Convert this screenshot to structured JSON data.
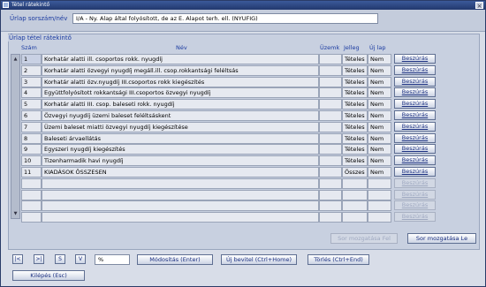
{
  "window": {
    "title": "Tétel rátekintő",
    "close": "×"
  },
  "form": {
    "label": "Űrlap sorszám/név",
    "value": "I/A  -  Ny. Alap által folyósított, de az E. Alapot terh. ell. (NYUFIG)"
  },
  "group": {
    "title": "Űrlap tétel rátekintő"
  },
  "columns": {
    "szam": "Szám",
    "nev": "Név",
    "uzemk": "Üzemk",
    "jelleg": "Jelleg",
    "ujlap": "Új lap"
  },
  "rows": [
    {
      "szam": "1",
      "nev": "Korhatár alatti ill. csoportos rokk. nyugdíj",
      "uzemk": "",
      "jelleg": "Tételes",
      "ujlap": "Nem",
      "btn": "Beszúrás"
    },
    {
      "szam": "2",
      "nev": "Korhatár alatti özvegyi nyugdíj megáll.ill. csop.rokkantsági feléltsás",
      "uzemk": "",
      "jelleg": "Tételes",
      "ujlap": "Nem",
      "btn": "Beszúrás"
    },
    {
      "szam": "3",
      "nev": "Korhatár alatti özv.nyugdíj III.csoportos rokk kiegészítés",
      "uzemk": "",
      "jelleg": "Tételes",
      "ujlap": "Nem",
      "btn": "Beszúrás"
    },
    {
      "szam": "4",
      "nev": "Együttfolyósított rokkantsági III.csoportos özvegyi nyugdíj",
      "uzemk": "",
      "jelleg": "Tételes",
      "ujlap": "Nem",
      "btn": "Beszúrás"
    },
    {
      "szam": "5",
      "nev": "Korhatár alatti III. csop. baleseti rokk. nyugdíj",
      "uzemk": "",
      "jelleg": "Tételes",
      "ujlap": "Nem",
      "btn": "Beszúrás"
    },
    {
      "szam": "6",
      "nev": "Özvegyi nyugdíj üzemi baleset feléltsáskent",
      "uzemk": "",
      "jelleg": "Tételes",
      "ujlap": "Nem",
      "btn": "Beszúrás"
    },
    {
      "szam": "7",
      "nev": "Üzemi baleset miatti özvegyi nyugdíj kiegészítése",
      "uzemk": "",
      "jelleg": "Tételes",
      "ujlap": "Nem",
      "btn": "Beszúrás"
    },
    {
      "szam": "8",
      "nev": "Baleseti árvaellátás",
      "uzemk": "",
      "jelleg": "Tételes",
      "ujlap": "Nem",
      "btn": "Beszúrás"
    },
    {
      "szam": "9",
      "nev": "Egyszeri nyugdíj kiegészítés",
      "uzemk": "",
      "jelleg": "Tételes",
      "ujlap": "Nem",
      "btn": "Beszúrás"
    },
    {
      "szam": "10",
      "nev": "Tizenharmadik havi nyugdíj",
      "uzemk": "",
      "jelleg": "Tételes",
      "ujlap": "Nem",
      "btn": "Beszúrás"
    },
    {
      "szam": "11",
      "nev": "KIADÁSOK ÖSSZESEN",
      "uzemk": "",
      "jelleg": "Összes",
      "ujlap": "Nem",
      "btn": "Beszúrás"
    },
    {
      "szam": "",
      "nev": "",
      "uzemk": "",
      "jelleg": "",
      "ujlap": "",
      "btn": "Beszúrás"
    },
    {
      "szam": "",
      "nev": "",
      "uzemk": "",
      "jelleg": "",
      "ujlap": "",
      "btn": "Beszúrás"
    },
    {
      "szam": "",
      "nev": "",
      "uzemk": "",
      "jelleg": "",
      "ujlap": "",
      "btn": "Beszúrás"
    },
    {
      "szam": "",
      "nev": "",
      "uzemk": "",
      "jelleg": "",
      "ujlap": "",
      "btn": "Beszúrás"
    }
  ],
  "move": {
    "up": "Sor mozgatása Fel",
    "down": "Sor mozgatása Le"
  },
  "nav": {
    "first": "|<",
    "last": ">|",
    "s": "S",
    "v": "V",
    "percent": "%"
  },
  "actions": {
    "modify": "Módosítás (Enter)",
    "new": "Új bevitel (Ctrl+Home)",
    "delete": "Törlés (Ctrl+End)",
    "exit": "Kilépés (Esc)"
  },
  "colors": {
    "label_blue": "#1a3aa0",
    "window_bg": "#d8dde8",
    "desktop": "#6a80a8"
  }
}
